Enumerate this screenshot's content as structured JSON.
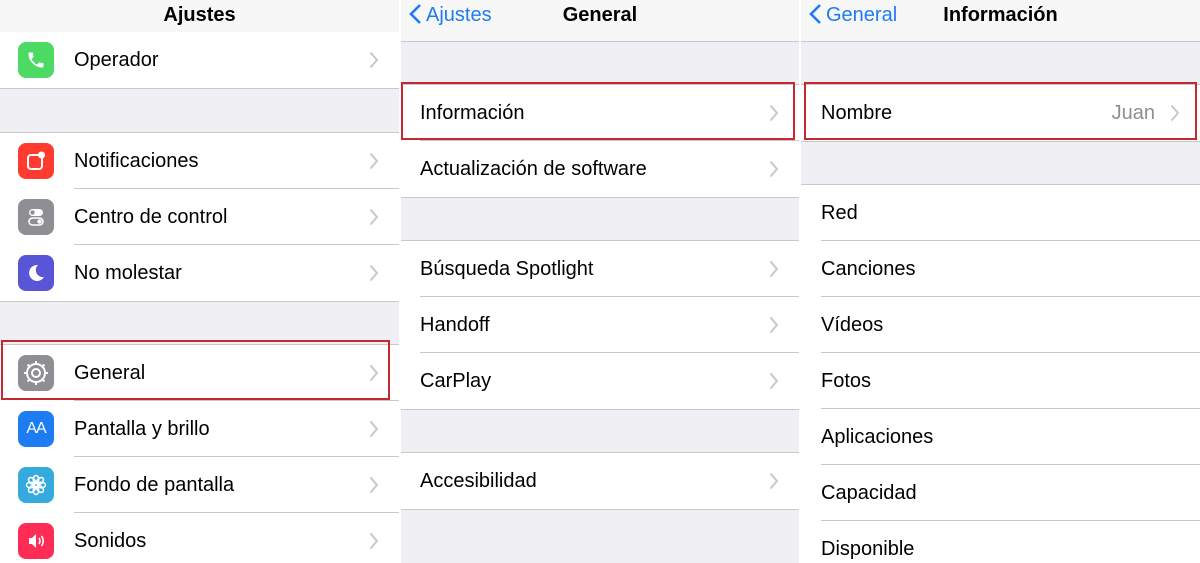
{
  "panel1": {
    "title": "Ajustes",
    "top_item": {
      "label": "Operador",
      "icon": "phone-icon",
      "color": "#4cd964"
    },
    "group2": [
      {
        "label": "Notificaciones",
        "icon": "notifications-icon",
        "color": "#ff3b30"
      },
      {
        "label": "Centro de control",
        "icon": "control-center-icon",
        "color": "#8e8e93"
      },
      {
        "label": "No molestar",
        "icon": "moon-icon",
        "color": "#5856d6"
      }
    ],
    "group3": [
      {
        "label": "General",
        "icon": "gear-icon",
        "color": "#8e8e93"
      },
      {
        "label": "Pantalla y brillo",
        "icon": "display-brightness-icon",
        "color": "#1e7cf2"
      },
      {
        "label": "Fondo de pantalla",
        "icon": "wallpaper-icon",
        "color": "#35aadc"
      },
      {
        "label": "Sonidos",
        "icon": "speaker-icon",
        "color": "#ff2d55"
      }
    ],
    "aa_glyph": "AA"
  },
  "panel2": {
    "back_label": "Ajustes",
    "title": "General",
    "group1": [
      {
        "label": "Información"
      },
      {
        "label": "Actualización de software"
      }
    ],
    "group2": [
      {
        "label": "Búsqueda Spotlight"
      },
      {
        "label": "Handoff"
      },
      {
        "label": "CarPlay"
      }
    ],
    "group3": [
      {
        "label": "Accesibilidad"
      }
    ]
  },
  "panel3": {
    "back_label": "General",
    "title": "Información",
    "name_row": {
      "label": "Nombre",
      "value": "Juan"
    },
    "info_rows": [
      {
        "label": "Red"
      },
      {
        "label": "Canciones"
      },
      {
        "label": "Vídeos"
      },
      {
        "label": "Fotos"
      },
      {
        "label": "Aplicaciones"
      },
      {
        "label": "Capacidad"
      },
      {
        "label": "Disponible"
      }
    ]
  },
  "colors": {
    "accent": "#1e7cf2",
    "highlight": "#c7272e",
    "background": "#efeff4"
  }
}
